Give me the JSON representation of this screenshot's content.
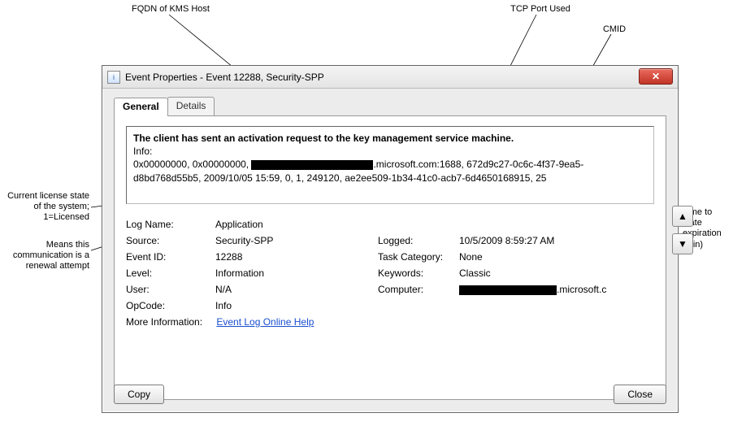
{
  "annotations": {
    "fqdn": "FQDN of KMS Host",
    "port": "TCP Port Used",
    "cmid": "CMID",
    "license_state": "Current license state of the system; 1=Licensed",
    "renewal": "Means this communication is a renewal attempt",
    "expiration": "Time to state expiration (min)"
  },
  "dialog": {
    "title": "Event Properties - Event 12288, Security-SPP",
    "tabs": {
      "general": "General",
      "details": "Details"
    },
    "desc": {
      "line1": "The client has sent an activation request to the key management service machine.",
      "line2": "Info:",
      "line3a": "0x00000000, 0x00000000, ",
      "line3b": ".microsoft.com:1688, 672d9c27-0c6c-4f37-9ea5-",
      "line4": "d8bd768d55b5, 2009/10/05 15:59, 0, 1, 249120, ae2ee509-1b34-41c0-acb7-6d4650168915, 25"
    },
    "fields": {
      "logname_l": "Log Name:",
      "logname_v": "Application",
      "source_l": "Source:",
      "source_v": "Security-SPP",
      "logged_l": "Logged:",
      "logged_v": "10/5/2009 8:59:27 AM",
      "eventid_l": "Event ID:",
      "eventid_v": "12288",
      "taskcat_l": "Task Category:",
      "taskcat_v": "None",
      "level_l": "Level:",
      "level_v": "Information",
      "keywords_l": "Keywords:",
      "keywords_v": "Classic",
      "user_l": "User:",
      "user_v": "N/A",
      "computer_l": "Computer:",
      "computer_v_suffix": ".microsoft.c",
      "opcode_l": "OpCode:",
      "opcode_v": "Info",
      "moreinfo_l": "More Information:",
      "moreinfo_link": "Event Log Online Help"
    },
    "buttons": {
      "copy": "Copy",
      "close": "Close"
    },
    "nav": {
      "up": "▲",
      "down": "▼"
    },
    "close_x": "✕"
  }
}
